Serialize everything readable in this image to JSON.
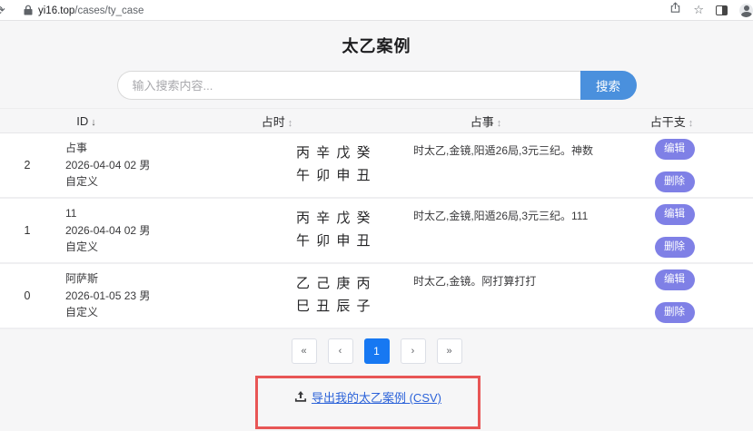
{
  "browser": {
    "url_host": "yi16.top",
    "url_path": "/cases/ty_case"
  },
  "page": {
    "title": "太乙案例",
    "search": {
      "placeholder": "输入搜索内容...",
      "button": "搜索"
    },
    "table": {
      "headers": [
        {
          "label": "ID",
          "arrow": "↓"
        },
        {
          "label": "占时",
          "arrow": "↕"
        },
        {
          "label": "占事",
          "arrow": "↕"
        },
        {
          "label": "占干支",
          "arrow": "↕"
        }
      ],
      "actions": {
        "edit": "编辑",
        "delete": "删除"
      },
      "rows": [
        {
          "id": "2",
          "name": "占事",
          "datetime": "2026-04-04 02 男",
          "type": "自定义",
          "stems": "丙 辛 戊 癸",
          "branches": "午 卯 申 丑",
          "description": "时太乙,金镜,阳遁26局,3元三纪。神数"
        },
        {
          "id": "1",
          "name": "11",
          "datetime": "2026-04-04 02 男",
          "type": "自定义",
          "stems": "丙 辛 戊 癸",
          "branches": "午 卯 申 丑",
          "description": "时太乙,金镜,阳遁26局,3元三纪。111"
        },
        {
          "id": "0",
          "name": "阿萨斯",
          "datetime": "2026-01-05 23 男",
          "type": "自定义",
          "stems": "乙 己 庚 丙",
          "branches": "巳 丑 辰 子",
          "description": "时太乙,金镜。阿打算打打"
        }
      ]
    },
    "pagination": {
      "items": [
        "«",
        "‹",
        "1",
        "›",
        "»"
      ],
      "current_page": "1"
    },
    "export": {
      "label": "导出我的太乙案例 (CSV)"
    }
  },
  "colors": {
    "search_button": "#4a90dd",
    "action_pill": "#7f80e6",
    "active_page": "#1778f2",
    "link": "#2b62d9",
    "annotation_red": "#e85656"
  }
}
